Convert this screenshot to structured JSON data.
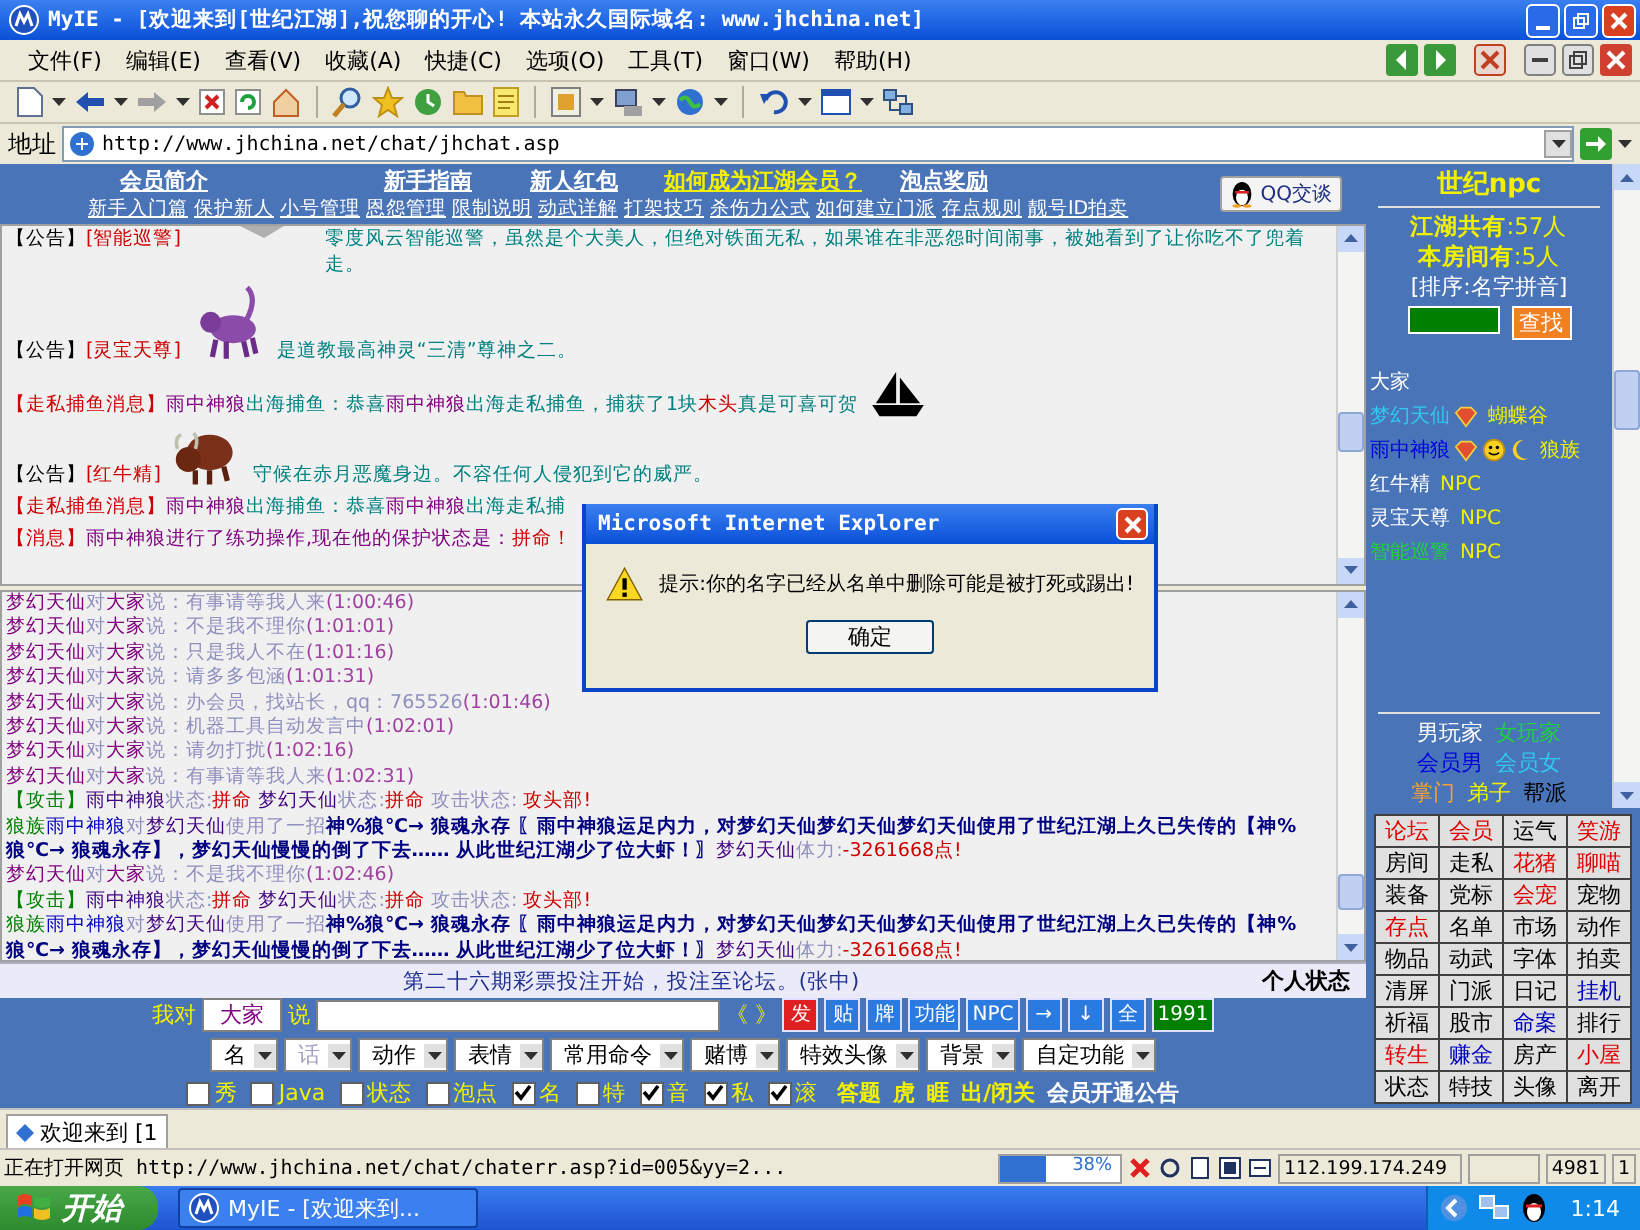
{
  "window": {
    "title": "MyIE - [欢迎来到[世纪江湖],祝您聊的开心! 本站永久国际域名: www.jhchina.net]"
  },
  "menu": [
    "文件(F)",
    "编辑(E)",
    "查看(V)",
    "收藏(A)",
    "快捷(C)",
    "选项(O)",
    "工具(T)",
    "窗口(W)",
    "帮助(H)"
  ],
  "address": {
    "label": "地址",
    "url": "http://www.jhchina.net/chat/jhchat.asp"
  },
  "nav": {
    "primary": [
      {
        "label": "会员简介",
        "highlight": false
      },
      {
        "label": "新手指南",
        "highlight": false
      },
      {
        "label": "新人红包",
        "highlight": false
      },
      {
        "label": "如何成为江湖会员？",
        "highlight": true
      },
      {
        "label": "泡点奖励",
        "highlight": false
      }
    ],
    "secondary": [
      "新手入门篇",
      "保护新人",
      "小号管理",
      "恩怨管理",
      "限制说明",
      "动武详解",
      "打架技巧",
      "杀伤力公式",
      "如何建立门派",
      "存点规则",
      "靓号ID拍卖"
    ],
    "qq_button": "QQ交谈"
  },
  "upper_chat": [
    {
      "head": [
        {
          "text": "【公告】",
          "kind": "label"
        },
        {
          "text": "[智能巡警]",
          "kind": "source"
        }
      ],
      "figure": {
        "kind": "cropped"
      },
      "body": [
        {
          "text": "零度风云智能巡警，虽然是个大美人，但绝对铁面无私，如果谁在非恶怨时间闹事，被她看到了让你吃不了兜着走。",
          "kind": "narration"
        }
      ]
    },
    {
      "head": [
        {
          "text": "【公告】",
          "kind": "label"
        },
        {
          "text": "[灵宝天尊]",
          "kind": "source"
        }
      ],
      "figure": {
        "kind": "purple-beast"
      },
      "body": [
        {
          "text": "是道教最高神灵“三清”尊神之二。",
          "kind": "narration"
        }
      ]
    },
    {
      "head": [
        {
          "text": "【走私捕鱼消息】",
          "kind": "source"
        }
      ],
      "figure": {
        "kind": "boat"
      },
      "body": [
        {
          "text": "雨中神狼",
          "kind": "actor"
        },
        {
          "text": "出海捕鱼：恭喜",
          "kind": "narration"
        },
        {
          "text": "雨中神狼",
          "kind": "actor"
        },
        {
          "text": "出海走私捕鱼，捕获了1块",
          "kind": "narration"
        },
        {
          "text": "木头",
          "kind": "alert"
        },
        {
          "text": "真是可喜可贺",
          "kind": "narration"
        }
      ]
    },
    {
      "head": [
        {
          "text": "【公告】",
          "kind": "label"
        },
        {
          "text": "[红牛精]",
          "kind": "source"
        }
      ],
      "figure": {
        "kind": "brown-beast"
      },
      "body": [
        {
          "text": "守候在赤月恶魔身边。不容任何人侵犯到它的威严。",
          "kind": "narration"
        }
      ]
    },
    {
      "head": [
        {
          "text": "【走私捕鱼消息】",
          "kind": "source"
        }
      ],
      "body": [
        {
          "text": "雨中神狼",
          "kind": "actor"
        },
        {
          "text": "出海捕鱼：恭喜",
          "kind": "narration"
        },
        {
          "text": "雨中神狼",
          "kind": "actor"
        },
        {
          "text": "出海走私捕",
          "kind": "narration"
        }
      ]
    },
    {
      "head": [
        {
          "text": "【消息】",
          "kind": "source"
        }
      ],
      "body": [
        {
          "text": "雨中神狼",
          "kind": "actor"
        },
        {
          "text": "进行了练功操作,现在他的保护状态是：",
          "kind": "actor"
        },
        {
          "text": "拼命！",
          "kind": "alert"
        }
      ]
    }
  ],
  "lower_chat": [
    [
      {
        "text": "梦幻天仙",
        "kind": "actor"
      },
      {
        "text": "对",
        "kind": "muted"
      },
      {
        "text": "大家",
        "kind": "actor"
      },
      {
        "text": "说：有事请等我人来",
        "kind": "muted"
      },
      {
        "text": "(1:00:46)",
        "kind": "time"
      }
    ],
    [
      {
        "text": "梦幻天仙",
        "kind": "actor"
      },
      {
        "text": "对",
        "kind": "muted"
      },
      {
        "text": "大家",
        "kind": "actor"
      },
      {
        "text": "说：不是我不理你",
        "kind": "muted"
      },
      {
        "text": "(1:01:01)",
        "kind": "time"
      }
    ],
    [
      {
        "text": "梦幻天仙",
        "kind": "actor"
      },
      {
        "text": "对",
        "kind": "muted"
      },
      {
        "text": "大家",
        "kind": "actor"
      },
      {
        "text": "说：只是我人不在",
        "kind": "muted"
      },
      {
        "text": "(1:01:16)",
        "kind": "time"
      }
    ],
    [
      {
        "text": "梦幻天仙",
        "kind": "actor"
      },
      {
        "text": "对",
        "kind": "muted"
      },
      {
        "text": "大家",
        "kind": "actor"
      },
      {
        "text": "说：请多多包涵",
        "kind": "muted"
      },
      {
        "text": "(1:01:31)",
        "kind": "time"
      }
    ],
    [
      {
        "text": "梦幻天仙",
        "kind": "actor"
      },
      {
        "text": "对",
        "kind": "muted"
      },
      {
        "text": "大家",
        "kind": "actor"
      },
      {
        "text": "说：办会员，找站长，qq：765526",
        "kind": "muted"
      },
      {
        "text": "(1:01:46)",
        "kind": "time"
      }
    ],
    [
      {
        "text": "梦幻天仙",
        "kind": "actor"
      },
      {
        "text": "对",
        "kind": "muted"
      },
      {
        "text": "大家",
        "kind": "actor"
      },
      {
        "text": "说：机器工具自动发言中",
        "kind": "muted"
      },
      {
        "text": "(1:02:01)",
        "kind": "time"
      }
    ],
    [
      {
        "text": "梦幻天仙",
        "kind": "actor"
      },
      {
        "text": "对",
        "kind": "muted"
      },
      {
        "text": "大家",
        "kind": "actor"
      },
      {
        "text": "说：请勿打扰",
        "kind": "muted"
      },
      {
        "text": "(1:02:16)",
        "kind": "time"
      }
    ],
    [
      {
        "text": "梦幻天仙",
        "kind": "actor"
      },
      {
        "text": "对",
        "kind": "muted"
      },
      {
        "text": "大家",
        "kind": "actor"
      },
      {
        "text": "说：有事请等我人来",
        "kind": "muted"
      },
      {
        "text": "(1:02:31)",
        "kind": "time"
      }
    ],
    [
      {
        "text": "【攻击】",
        "kind": "attack"
      },
      {
        "text": "雨中神狼",
        "kind": "fighter"
      },
      {
        "text": "状态:",
        "kind": "muted"
      },
      {
        "text": "拼命",
        "kind": "alert"
      },
      {
        "text": " 梦幻天仙",
        "kind": "fighter"
      },
      {
        "text": "状态:",
        "kind": "muted"
      },
      {
        "text": "拼命",
        "kind": "alert"
      },
      {
        "text": " 攻击状态:",
        "kind": "muted"
      },
      {
        "text": " 攻头部!",
        "kind": "alert"
      }
    ],
    [
      {
        "text": "狼族",
        "kind": "attack"
      },
      {
        "text": "雨中神狼",
        "kind": "attacker"
      },
      {
        "text": "对",
        "kind": "muted"
      },
      {
        "text": "梦幻天仙",
        "kind": "fighter"
      },
      {
        "text": "使用了一招",
        "kind": "muted"
      },
      {
        "text": "神%狼℃→ 狼魂永存",
        "kind": "skill"
      },
      {
        "text": " 〖雨中神狼运足内力，对梦幻天仙梦幻天仙梦幻天仙使用了世纪江湖上久已失传的【神%狼℃→ 狼魂永存】，梦幻天仙慢慢的倒了下去…… 从此世纪江湖少了位大虾！〗",
        "kind": "skill"
      },
      {
        "text": "梦幻天仙",
        "kind": "fighter"
      },
      {
        "text": "体力:",
        "kind": "muted"
      },
      {
        "text": "-3261668点!",
        "kind": "alert"
      }
    ],
    [
      {
        "text": "梦幻天仙",
        "kind": "actor"
      },
      {
        "text": "对",
        "kind": "muted"
      },
      {
        "text": "大家",
        "kind": "actor"
      },
      {
        "text": "说：不是我不理你",
        "kind": "muted"
      },
      {
        "text": "(1:02:46)",
        "kind": "time"
      }
    ],
    [
      {
        "text": "【攻击】",
        "kind": "attack"
      },
      {
        "text": "雨中神狼",
        "kind": "fighter"
      },
      {
        "text": "状态:",
        "kind": "muted"
      },
      {
        "text": "拼命",
        "kind": "alert"
      },
      {
        "text": " 梦幻天仙",
        "kind": "fighter"
      },
      {
        "text": "状态:",
        "kind": "muted"
      },
      {
        "text": "拼命",
        "kind": "alert"
      },
      {
        "text": " 攻击状态:",
        "kind": "muted"
      },
      {
        "text": " 攻头部!",
        "kind": "alert"
      }
    ],
    [
      {
        "text": "狼族",
        "kind": "attack"
      },
      {
        "text": "雨中神狼",
        "kind": "attacker"
      },
      {
        "text": "对",
        "kind": "muted"
      },
      {
        "text": "梦幻天仙",
        "kind": "fighter"
      },
      {
        "text": "使用了一招",
        "kind": "muted"
      },
      {
        "text": "神%狼℃→ 狼魂永存",
        "kind": "skill"
      },
      {
        "text": " 〖雨中神狼运足内力，对梦幻天仙梦幻天仙梦幻天仙使用了世纪江湖上久已失传的【神%狼℃→ 狼魂永存】，梦幻天仙慢慢的倒了下去…… 从此世纪江湖少了位大虾！〗",
        "kind": "skill"
      },
      {
        "text": "梦幻天仙",
        "kind": "fighter"
      },
      {
        "text": "体力:",
        "kind": "muted"
      },
      {
        "text": "-3261668点!",
        "kind": "alert"
      }
    ]
  ],
  "dialog": {
    "title": "Microsoft Internet Explorer",
    "message": "提示:你的名字已经从名单中删除可能是被打死或踢出!",
    "button": "确定"
  },
  "announcement": {
    "text": "第二十六期彩票投注开始，投注至论坛。(张中)",
    "status_link": "个人状态"
  },
  "input_panel": {
    "prefix": "我对",
    "target": "大家",
    "suffix": "说",
    "brackets": "《 》",
    "buttons": [
      {
        "label": "发",
        "color": "#e02020"
      },
      {
        "label": "贴",
        "color": "#2a7ae0"
      },
      {
        "label": "牌",
        "color": "#2a7ae0"
      },
      {
        "label": "功能",
        "color": "#2a7ae0"
      },
      {
        "label": "NPC",
        "color": "#2a7ae0"
      },
      {
        "label": "→",
        "color": "#2a7ae0"
      },
      {
        "label": "↓",
        "color": "#2a7ae0"
      },
      {
        "label": "全",
        "color": "#2a7ae0"
      },
      {
        "label": "1991",
        "color": "#008000"
      }
    ],
    "selects": [
      {
        "label": "名",
        "disabled": false
      },
      {
        "label": "话",
        "disabled": true
      },
      {
        "label": "动作",
        "disabled": false
      },
      {
        "label": "表情",
        "disabled": false
      },
      {
        "label": "常用命令",
        "disabled": false
      },
      {
        "label": "赌博",
        "disabled": false
      },
      {
        "label": "特效头像",
        "disabled": false
      },
      {
        "label": "背景",
        "disabled": false
      },
      {
        "label": "自定功能",
        "disabled": false
      }
    ],
    "checks": [
      {
        "label": "秀",
        "checked": false
      },
      {
        "label": "Java",
        "checked": false
      },
      {
        "label": "状态",
        "checked": false
      },
      {
        "label": "泡点",
        "checked": false
      },
      {
        "label": "名",
        "checked": true
      },
      {
        "label": "特",
        "checked": false
      },
      {
        "label": "音",
        "checked": true
      },
      {
        "label": "私",
        "checked": true
      },
      {
        "label": "滚",
        "checked": true
      }
    ],
    "links": [
      {
        "label": "答题",
        "color": "#f0f000"
      },
      {
        "label": "虎",
        "color": "#f0f000"
      },
      {
        "label": "睚",
        "color": "#f0f000"
      },
      {
        "label": "出/闭关",
        "color": "#f0f000"
      },
      {
        "label": "会员开通公告",
        "color": "#ffffff"
      }
    ]
  },
  "sidebar": {
    "title": "世纪npc",
    "total": "**江湖共有**:57人",
    "room": "**本房间有**:5人",
    "sort": "[排序:名字拼音]",
    "search_button": "查找",
    "users": [
      {
        "name": "大家",
        "kind": "all",
        "color": "#ffffff"
      },
      {
        "name": "梦幻天仙",
        "kind": "female",
        "color": "#30c8f0",
        "tag": "蝴蝶谷"
      },
      {
        "name": "雨中神狼",
        "kind": "male",
        "color": "#0000e0",
        "tag": "狼族"
      },
      {
        "name": "红牛精",
        "kind": "npc",
        "color": "#ffffff",
        "tag": "NPC"
      },
      {
        "name": "灵宝天尊",
        "kind": "npc",
        "color": "#ffffff",
        "tag": "NPC"
      },
      {
        "name": "智能巡警",
        "kind": "npc",
        "color": "#20d040",
        "tag": "NPC"
      }
    ],
    "legend": [
      [
        {
          "label": "男玩家",
          "color": "#ffffff"
        },
        {
          "label": "女玩家",
          "color": "#20d040"
        }
      ],
      [
        {
          "label": "会员男",
          "color": "#0000e0"
        },
        {
          "label": "会员女",
          "color": "#30c8f0"
        }
      ],
      [
        {
          "label": "掌门",
          "color": "#f0a030"
        },
        {
          "label": "弟子",
          "color": "#f0f000"
        },
        {
          "label": "帮派",
          "color": "#000000"
        }
      ]
    ],
    "commands": [
      {
        "label": "论坛",
        "color": "#e00000"
      },
      {
        "label": "会员",
        "color": "#e00000"
      },
      {
        "label": "运气",
        "color": "#000000"
      },
      {
        "label": "笑游",
        "color": "#e00000"
      },
      {
        "label": "房间",
        "color": "#000000"
      },
      {
        "label": "走私",
        "color": "#000000"
      },
      {
        "label": "花猪",
        "color": "#e00000"
      },
      {
        "label": "聊喵",
        "color": "#e00000"
      },
      {
        "label": "装备",
        "color": "#000000"
      },
      {
        "label": "党标",
        "color": "#000000"
      },
      {
        "label": "会宠",
        "color": "#e00000"
      },
      {
        "label": "宠物",
        "color": "#000000"
      },
      {
        "label": "存点",
        "color": "#e00000"
      },
      {
        "label": "名单",
        "color": "#000000"
      },
      {
        "label": "市场",
        "color": "#000000"
      },
      {
        "label": "动作",
        "color": "#000000"
      },
      {
        "label": "物品",
        "color": "#000000"
      },
      {
        "label": "动武",
        "color": "#000000"
      },
      {
        "label": "字体",
        "color": "#000000"
      },
      {
        "label": "拍卖",
        "color": "#000000"
      },
      {
        "label": "清屏",
        "color": "#000000"
      },
      {
        "label": "门派",
        "color": "#000000"
      },
      {
        "label": "日记",
        "color": "#000000"
      },
      {
        "label": "挂机",
        "color": "#0000c0"
      },
      {
        "label": "祈福",
        "color": "#000000"
      },
      {
        "label": "股市",
        "color": "#000000"
      },
      {
        "label": "命案",
        "color": "#0000c0"
      },
      {
        "label": "排行",
        "color": "#000000"
      },
      {
        "label": "转生",
        "color": "#e00000"
      },
      {
        "label": "赚金",
        "color": "#0000c0"
      },
      {
        "label": "房产",
        "color": "#000000"
      },
      {
        "label": "小屋",
        "color": "#e00000"
      },
      {
        "label": "状态",
        "color": "#000000"
      },
      {
        "label": "特技",
        "color": "#000000"
      },
      {
        "label": "头像",
        "color": "#000000"
      },
      {
        "label": "离开",
        "color": "#000000"
      }
    ]
  },
  "tabs": [
    {
      "label": "欢迎来到 [1",
      "selected": true
    }
  ],
  "status_bar": {
    "text": "正在打开网页",
    "url": "http://www.jhchina.net/chat/chaterr.asp?id=005&yy=2...",
    "progress": {
      "level": 0.38,
      "reading": "38%"
    },
    "ip": "112.199.174.249",
    "code": "4981",
    "pane": "1"
  },
  "taskbar": {
    "start": "开始",
    "task": "MyIE - [欢迎来到...",
    "time": "1:14"
  }
}
